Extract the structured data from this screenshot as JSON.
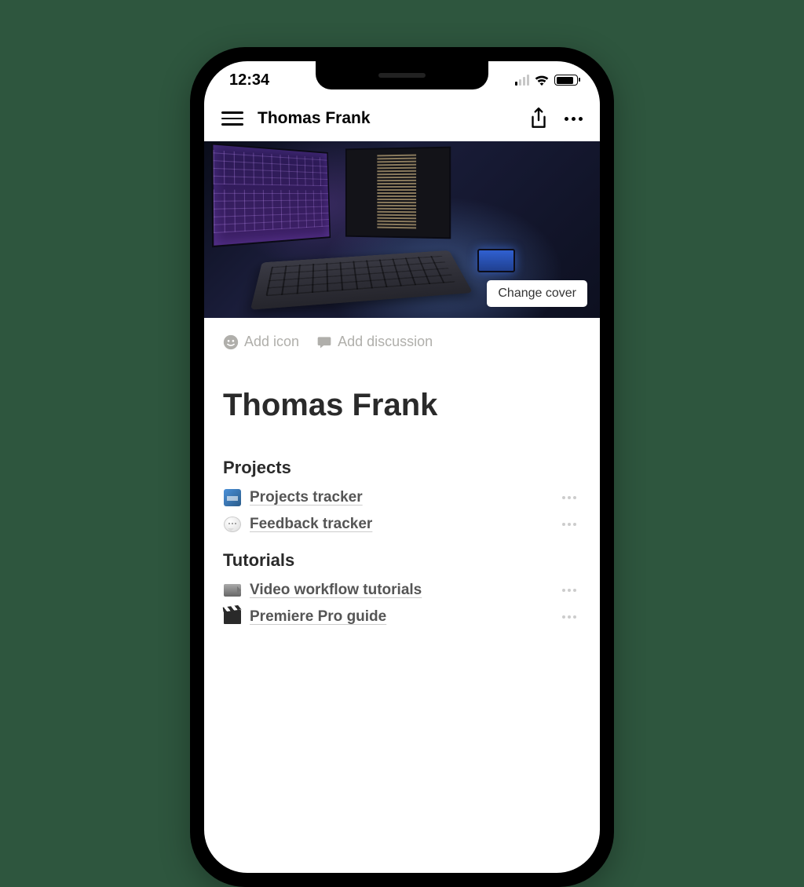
{
  "status_bar": {
    "time": "12:34"
  },
  "header": {
    "title": "Thomas Frank"
  },
  "cover": {
    "change_label": "Change cover"
  },
  "page_actions": {
    "add_icon": "Add icon",
    "add_discussion": "Add discussion"
  },
  "page": {
    "title": "Thomas Frank"
  },
  "sections": [
    {
      "heading": "Projects",
      "items": [
        {
          "icon": "tracker-icon",
          "label": "Projects tracker"
        },
        {
          "icon": "chat-bubble-icon",
          "label": "Feedback tracker"
        }
      ]
    },
    {
      "heading": "Tutorials",
      "items": [
        {
          "icon": "video-camera-icon",
          "label": "Video workflow tutorials"
        },
        {
          "icon": "clapperboard-icon",
          "label": "Premiere Pro guide"
        }
      ]
    }
  ]
}
